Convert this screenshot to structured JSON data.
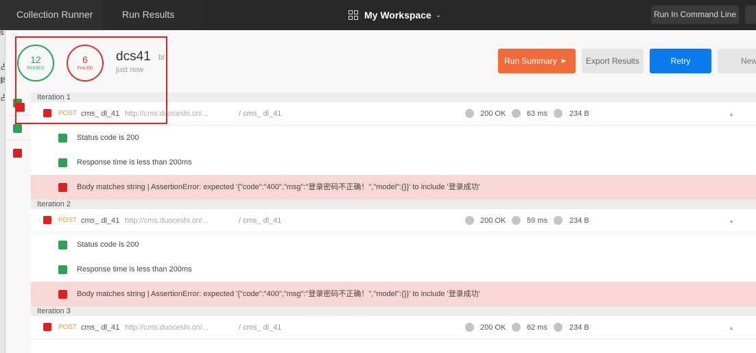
{
  "topbar": {
    "breadcrumb": [
      "Collection Runner",
      "Run Results"
    ],
    "workspace": "My Workspace",
    "run_cmdline": "Run In Command Line"
  },
  "summary": {
    "passed_count": "12",
    "passed_label": "PASSED",
    "failed_count": "6",
    "failed_label": "FAILED",
    "run_name": "dcs41",
    "run_suffix": "bl",
    "run_time": "just now"
  },
  "actions": {
    "run_summary": "Run Summary",
    "export": "Export Results",
    "retry": "Retry",
    "new": "New"
  },
  "left_edge_text": [
    "s",
    "专",
    "占",
    "錊",
    "占"
  ],
  "iterations": [
    {
      "label": "Iteration 1",
      "request": {
        "method": "POST",
        "name": "cms_ dl_41",
        "url": "http://cms.duoceshi.cn/...",
        "path": "/ cms_ dl_41",
        "status": "200 OK",
        "time": "63 ms",
        "size": "234 B"
      },
      "tests": [
        {
          "name": "Status code is 200",
          "passed": true
        },
        {
          "name": "Response time is less than 200ms",
          "passed": true
        },
        {
          "name": "Body matches string | AssertionError: expected '{\"code\":\"400\",\"msg\":\"登录密码不正确！\",\"model\":{}}' to include '登录成功'",
          "passed": false
        }
      ]
    },
    {
      "label": "Iteration 2",
      "request": {
        "method": "POST",
        "name": "cms_ dl_41",
        "url": "http://cms.duoceshi.cn/...",
        "path": "/ cms_ dl_41",
        "status": "200 OK",
        "time": "59 ms",
        "size": "234 B"
      },
      "tests": [
        {
          "name": "Status code is 200",
          "passed": true
        },
        {
          "name": "Response time is less than 200ms",
          "passed": true
        },
        {
          "name": "Body matches string | AssertionError: expected '{\"code\":\"400\",\"msg\":\"登录密码不正确！\",\"model\":{}}' to include '登录成功'",
          "passed": false
        }
      ]
    },
    {
      "label": "Iteration 3",
      "request": {
        "method": "POST",
        "name": "cms_ dl_41",
        "url": "http://cms.duoceshi.cn/...",
        "path": "/ cms_ dl_41",
        "status": "200 OK",
        "time": "62 ms",
        "size": "234 B"
      },
      "tests": []
    }
  ],
  "colors": {
    "passed": "#2aa355",
    "failed": "#e02020",
    "accent": "#f26b3a",
    "primary": "#097bed",
    "highlight": "#e02020"
  },
  "icons": {
    "workspace": "grid-icon",
    "caret": "chevron-down-icon",
    "run_summary": "chevron-right-icon",
    "collapse": "chevron-up-icon"
  }
}
